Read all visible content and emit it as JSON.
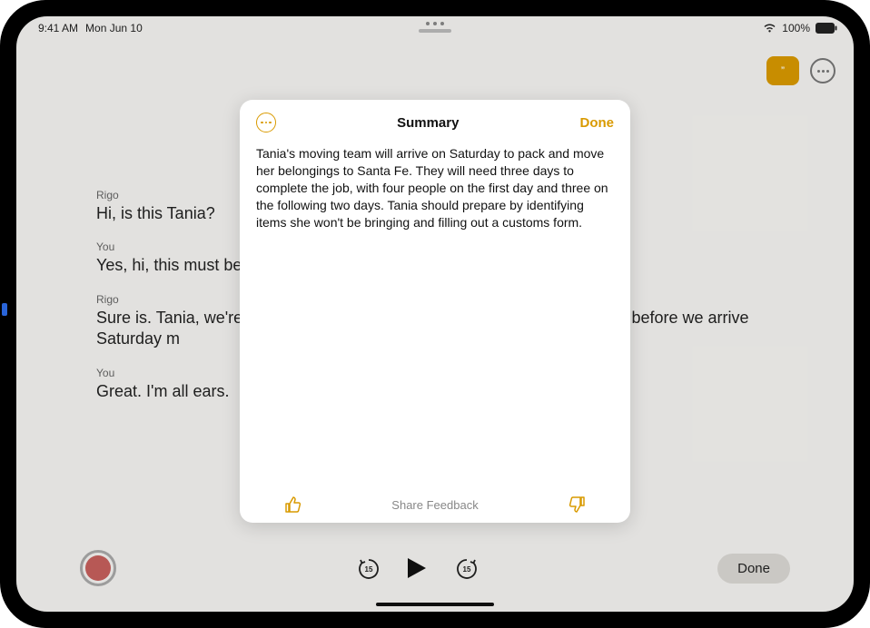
{
  "status": {
    "time": "9:41 AM",
    "date": "Mon Jun 10",
    "battery_percent": "100%"
  },
  "topright": {
    "quote_icon": "quote",
    "more_icon": "more"
  },
  "transcript": [
    {
      "speaker": "Rigo",
      "text": "Hi, is this Tania?"
    },
    {
      "speaker": "You",
      "text": "Yes, hi, this must be I"
    },
    {
      "speaker": "Rigo",
      "text": "Sure is. Tania, we're a                                                                                           o chat with you beforehand to go ove                                                                                        u might have before we arrive Saturday m"
    },
    {
      "speaker": "You",
      "text": "Great. I'm all ears."
    }
  ],
  "playback": {
    "skip_back": "15",
    "skip_forward": "15",
    "done_label": "Done"
  },
  "summary": {
    "title": "Summary",
    "done_label": "Done",
    "body": "Tania's moving team will arrive on Saturday to pack and move her belongings to Santa Fe. They will need three days to complete the job, with four people on the first day and three on the following two days. Tania should prepare by identifying items she won't be bringing and filling out a customs form.",
    "share_feedback_label": "Share Feedback"
  }
}
